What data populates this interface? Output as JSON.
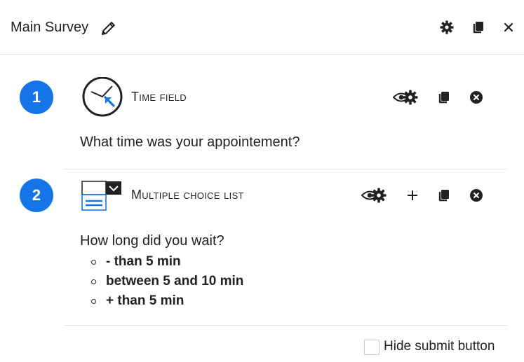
{
  "header": {
    "title": "Main Survey",
    "icons": [
      "pencil-icon",
      "gear-icon",
      "copy-icon",
      "close-icon"
    ]
  },
  "questions": [
    {
      "number": "1",
      "type_label": "Time field",
      "type_icon": "clock-icon",
      "text": "What time was your appointement?",
      "actions": [
        "visibility-settings-icon",
        "copy-icon",
        "delete-icon"
      ]
    },
    {
      "number": "2",
      "type_label": "Multiple choice list",
      "type_icon": "dropdown-list-icon",
      "text": "How long did you wait?",
      "options": [
        "- than 5 min",
        "between 5 and 10 min",
        "+ than 5 min"
      ],
      "actions": [
        "visibility-settings-icon",
        "add-icon",
        "copy-icon",
        "delete-icon"
      ]
    }
  ],
  "footer": {
    "hide_submit_label": "Hide submit button",
    "hide_submit_checked": false
  },
  "colors": {
    "accent": "#1575e8",
    "text": "#222222",
    "divider": "#e3e3e3"
  }
}
